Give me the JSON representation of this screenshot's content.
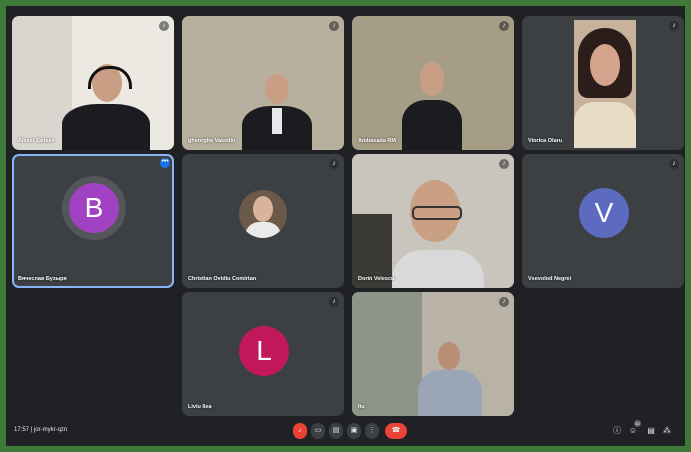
{
  "colors": {
    "border_green": "#3f7a3a",
    "background": "#202124",
    "tile": "#3c4043",
    "end_call": "#ea4335",
    "selected_outline": "#8ab4f8"
  },
  "participants": [
    {
      "name": "Alexei Zaitsev",
      "initial": ""
    },
    {
      "name": "gheorghe Vasedin",
      "initial": ""
    },
    {
      "name": "Ambasada RM",
      "initial": ""
    },
    {
      "name": "Viorica Olaru",
      "initial": ""
    },
    {
      "name": "Вячеслав Бузыря",
      "initial": "B",
      "color": "#a142c4"
    },
    {
      "name": "Christian Ovidiu Comirtan",
      "initial": ""
    },
    {
      "name": "Dorin Velescu",
      "initial": ""
    },
    {
      "name": "Vsevolod Negrei",
      "initial": "V",
      "color": "#5c6bc0"
    },
    {
      "name": "Liviu Ilea",
      "initial": "L",
      "color": "#c2185b"
    },
    {
      "name": "Itu",
      "initial": ""
    }
  ],
  "bottom_bar": {
    "time_meeting": "17:57 | jor-mykr-qzn",
    "people_count": "10"
  },
  "icons": {
    "mic": "mic-icon",
    "camera": "camera-icon",
    "captions": "captions-icon",
    "present": "present-icon",
    "more": "more-vert-icon",
    "end_call": "end-call-icon",
    "info": "info-icon",
    "people": "people-icon",
    "chat": "chat-icon",
    "activities": "activities-icon"
  }
}
